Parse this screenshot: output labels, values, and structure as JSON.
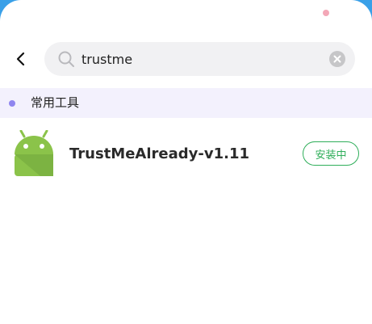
{
  "search": {
    "value": "trustme",
    "back_icon": "chevron-left-icon",
    "search_icon": "search-icon",
    "clear_icon": "clear-icon"
  },
  "section": {
    "title": "常用工具",
    "dot_color": "#8f85ef"
  },
  "apps": [
    {
      "name": "TrustMeAlready-v1.11",
      "icon": "android-icon",
      "status": "安装中",
      "status_color": "#2fae5a"
    }
  ]
}
